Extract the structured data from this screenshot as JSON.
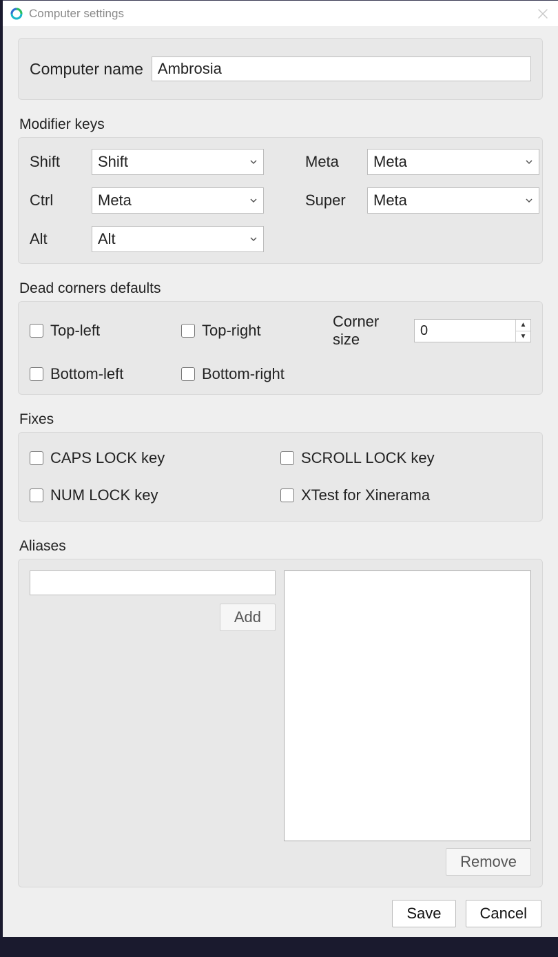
{
  "window": {
    "title": "Computer settings"
  },
  "name_section": {
    "label": "Computer name",
    "value": "Ambrosia"
  },
  "modifiers": {
    "section_label": "Modifier keys",
    "shift": {
      "label": "Shift",
      "value": "Shift"
    },
    "ctrl": {
      "label": "Ctrl",
      "value": "Meta"
    },
    "alt": {
      "label": "Alt",
      "value": "Alt"
    },
    "meta": {
      "label": "Meta",
      "value": "Meta"
    },
    "super": {
      "label": "Super",
      "value": "Meta"
    }
  },
  "deadcorners": {
    "section_label": "Dead corners defaults",
    "top_left": {
      "label": "Top-left",
      "checked": false
    },
    "top_right": {
      "label": "Top-right",
      "checked": false
    },
    "bottom_left": {
      "label": "Bottom-left",
      "checked": false
    },
    "bottom_right": {
      "label": "Bottom-right",
      "checked": false
    },
    "corner_size": {
      "label": "Corner size",
      "value": "0"
    }
  },
  "fixes": {
    "section_label": "Fixes",
    "caps_lock": {
      "label": "CAPS LOCK key",
      "checked": false
    },
    "scroll_lock": {
      "label": "SCROLL LOCK key",
      "checked": false
    },
    "num_lock": {
      "label": "NUM LOCK key",
      "checked": false
    },
    "xtest": {
      "label": "XTest for Xinerama",
      "checked": false
    }
  },
  "aliases": {
    "section_label": "Aliases",
    "input_value": "",
    "add_label": "Add",
    "remove_label": "Remove",
    "items": []
  },
  "footer": {
    "save_label": "Save",
    "cancel_label": "Cancel"
  }
}
